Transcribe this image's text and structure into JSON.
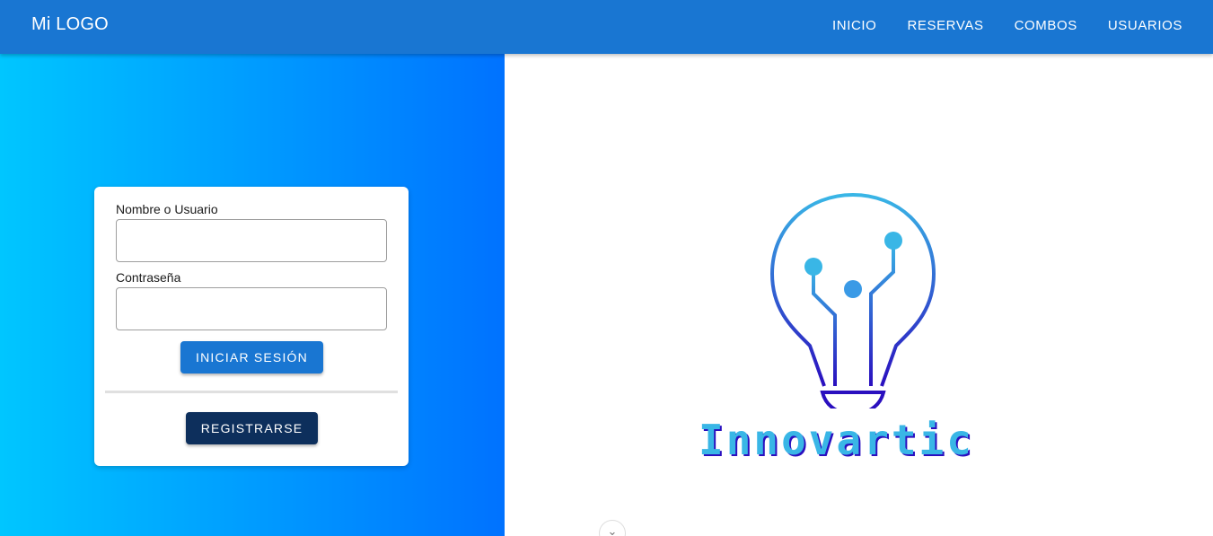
{
  "navbar": {
    "logo": "Mi LOGO",
    "links": [
      "INICIO",
      "RESERVAS",
      "COMBOS",
      "USUARIOS"
    ]
  },
  "login": {
    "username_label": "Nombre o Usuario",
    "username_value": "",
    "password_label": "Contraseña",
    "password_value": "",
    "login_button": "INICIAR SESIÓN",
    "register_button": "REGISTRARSE"
  },
  "brand": {
    "name": "Innovartic"
  },
  "scroll_hint": "⌄",
  "colors": {
    "navbar": "#1976d2",
    "gradient_start": "#00c6ff",
    "gradient_end": "#0072ff",
    "login_button": "#1976d2",
    "register_button": "#0d2f5c",
    "brand_cyan": "#39b6e6",
    "brand_violet": "#2a0fbf"
  }
}
